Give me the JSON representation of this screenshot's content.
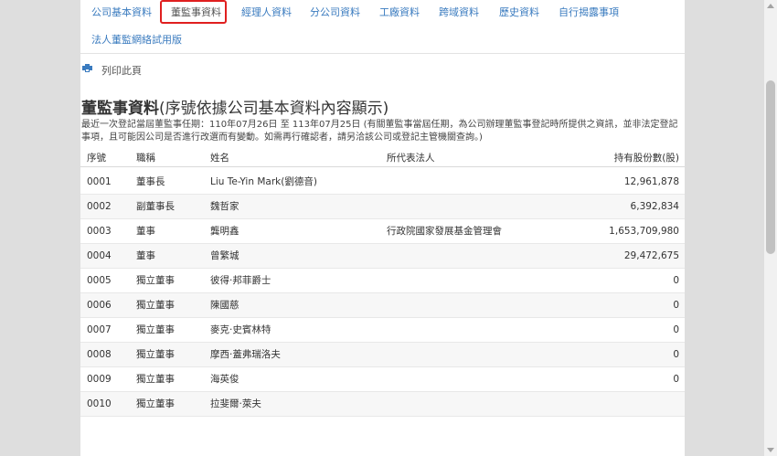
{
  "tabs": [
    {
      "label": "公司基本資料"
    },
    {
      "label": "董監事資料",
      "active": true
    },
    {
      "label": "經理人資料"
    },
    {
      "label": "分公司資料"
    },
    {
      "label": "工廠資料"
    },
    {
      "label": "跨域資料"
    },
    {
      "label": "歷史資料"
    },
    {
      "label": "自行揭露事項"
    },
    {
      "label": "法人董監網絡試用版"
    }
  ],
  "print": {
    "icon": "printer-icon",
    "label": "列印此頁"
  },
  "title": {
    "main": "董監事資料",
    "sub": "(序號依據公司基本資料內容顯示)"
  },
  "note": "最近一次登記當屆董監事任期：110年07月26日 至 113年07月25日 (有關董監事當屆任期，為公司辦理董監事登記時所提供之資訊，並非法定登記事項，且可能因公司是否進行改選而有變動。如需再行確認者，請另洽該公司或登記主管機關查詢。)",
  "table": {
    "headers": {
      "seq": "序號",
      "position": "職稱",
      "name": "姓名",
      "rep": "所代表法人",
      "shares": "持有股份數(股)"
    },
    "rows": [
      {
        "seq": "0001",
        "position": "董事長",
        "name": "Liu Te-Yin Mark(劉德音)",
        "rep": "",
        "shares": "12,961,878"
      },
      {
        "seq": "0002",
        "position": "副董事長",
        "name": "魏哲家",
        "rep": "",
        "shares": "6,392,834"
      },
      {
        "seq": "0003",
        "position": "董事",
        "name": "龔明鑫",
        "rep": "行政院國家發展基金管理會",
        "shares": "1,653,709,980"
      },
      {
        "seq": "0004",
        "position": "董事",
        "name": "曾繁城",
        "rep": "",
        "shares": "29,472,675"
      },
      {
        "seq": "0005",
        "position": "獨立董事",
        "name": "彼得‧邦菲爵士",
        "rep": "",
        "shares": "0"
      },
      {
        "seq": "0006",
        "position": "獨立董事",
        "name": "陳國慈",
        "rep": "",
        "shares": "0"
      },
      {
        "seq": "0007",
        "position": "獨立董事",
        "name": "麥克‧史賓林特",
        "rep": "",
        "shares": "0"
      },
      {
        "seq": "0008",
        "position": "獨立董事",
        "name": "摩西‧蓋弗瑞洛夫",
        "rep": "",
        "shares": "0"
      },
      {
        "seq": "0009",
        "position": "獨立董事",
        "name": "海英俊",
        "rep": "",
        "shares": "0"
      },
      {
        "seq": "0010",
        "position": "獨立董事",
        "name": "拉斐爾‧萊夫",
        "rep": "",
        "shares": ""
      }
    ]
  },
  "colors": {
    "link": "#3a7bbf",
    "highlight": "#e01f1f",
    "stripe": "#f7f7f7"
  }
}
